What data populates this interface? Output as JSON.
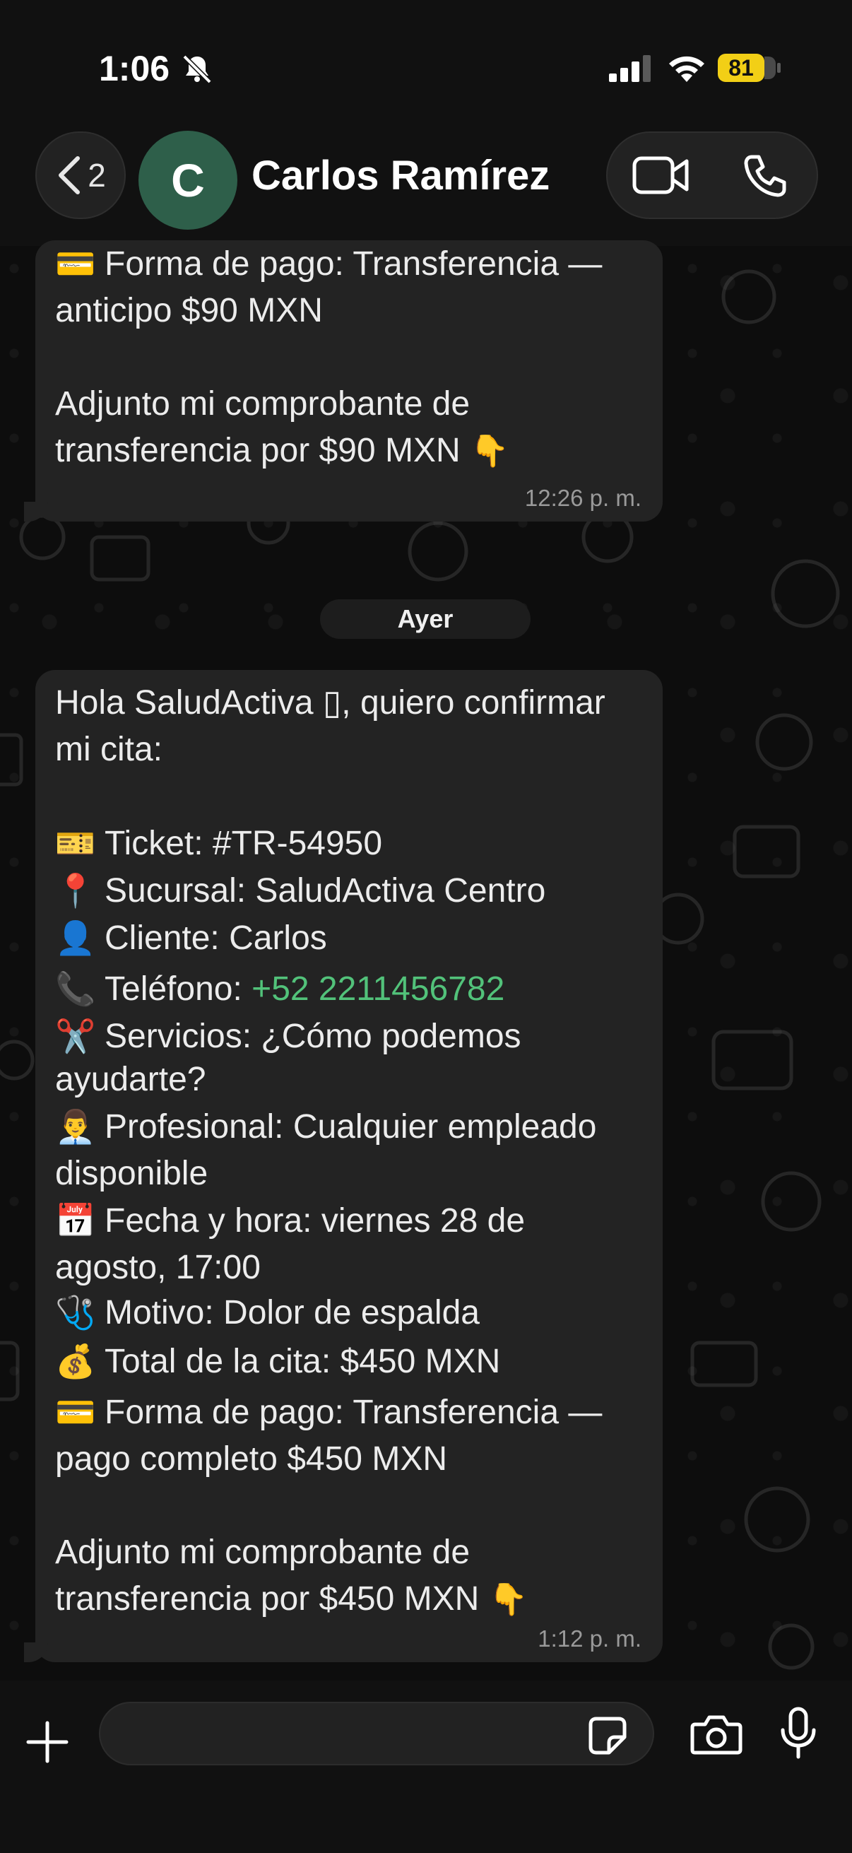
{
  "status_bar": {
    "time": "1:06",
    "battery": "81"
  },
  "header": {
    "back_count": "2",
    "avatar_letter": "C",
    "contact_name": "Carlos Ramírez"
  },
  "messages": [
    {
      "lines": [
        "Forma de pago: Transferencia —",
        "anticipo $90 MXN",
        "",
        "Adjunto mi comprobante de",
        "transferencia por $90 MXN"
      ],
      "time": "12:26 p. m."
    },
    {
      "lines": [
        "Hola SaludActiva ▯, quiero confirmar",
        "mi cita:",
        "",
        "Ticket: #TR-54950",
        "Sucursal: SaludActiva Centro",
        "Cliente: Carlos",
        "Teléfono: ",
        "Servicios: ¿Cómo podemos",
        "ayudarte?",
        "Profesional: Cualquier empleado",
        "disponible",
        "Fecha y hora: viernes 28 de",
        "agosto, 17:00",
        "Motivo: Dolor de espalda",
        "Total de la cita: $450 MXN",
        "Forma de pago: Transferencia —",
        "pago completo $450 MXN",
        "",
        "Adjunto mi comprobante de",
        "transferencia por $450 MXN"
      ],
      "phone": "+52 2211456782",
      "time": "1:12 p. m."
    }
  ],
  "date_separator": "Ayer",
  "composer": {
    "placeholder": ""
  },
  "icons": {
    "emoji_card": "💳",
    "emoji_point": "👇",
    "emoji_ticket": "🎫",
    "emoji_pin": "📍",
    "emoji_person": "👤",
    "emoji_phone": "📞",
    "emoji_scissors": "✂️",
    "emoji_pro": "👨‍💼",
    "emoji_calendar": "📅",
    "emoji_stethoscope": "🩺",
    "emoji_money": "💰"
  }
}
